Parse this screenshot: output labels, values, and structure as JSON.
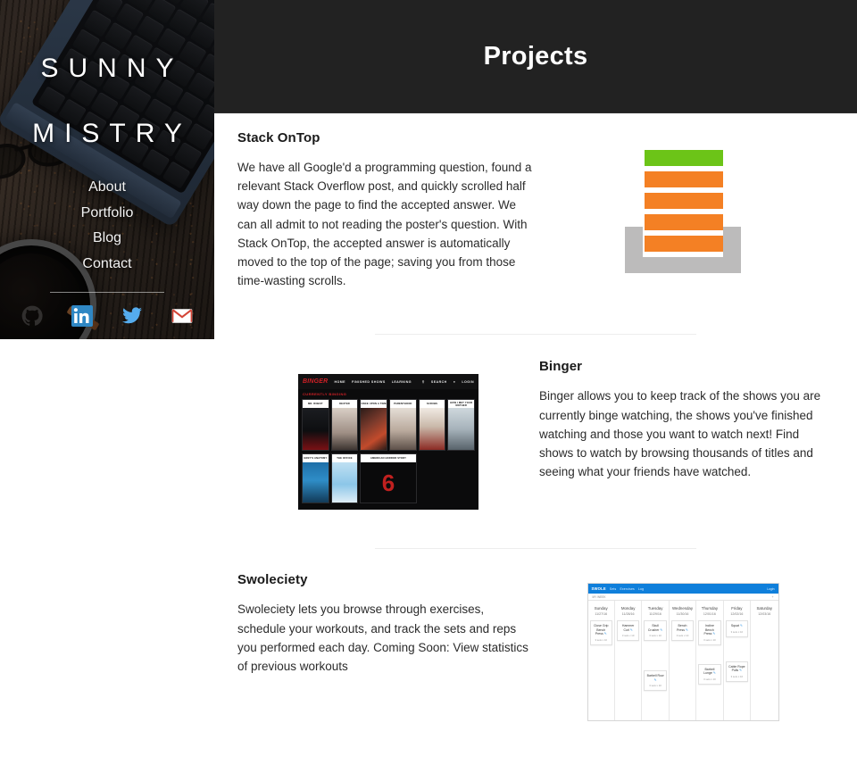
{
  "sidebar": {
    "brand_line1": "SUNNY",
    "brand_line2": "MISTRY",
    "nav": [
      {
        "label": "About"
      },
      {
        "label": "Portfolio"
      },
      {
        "label": "Blog"
      },
      {
        "label": "Contact"
      }
    ],
    "socials": [
      {
        "name": "github-icon",
        "label": "GitHub",
        "color": "#2b2b2b"
      },
      {
        "name": "linkedin-icon",
        "label": "LinkedIn",
        "color": "#2f87c4"
      },
      {
        "name": "twitter-icon",
        "label": "Twitter",
        "color": "#55acee"
      },
      {
        "name": "gmail-icon",
        "label": "Gmail",
        "color": "#d44638"
      }
    ]
  },
  "header": {
    "title": "Projects",
    "background": "#222222"
  },
  "projects": [
    {
      "title": "Stack OnTop",
      "body": "We have all Google'd a programming question, found a relevant Stack Overflow post, and quickly scrolled half way down the page to find the accepted answer. We can all admit to not reading the poster's question. With Stack OnTop, the accepted answer is automatically moved to the top of the page; saving you from those time-wasting scrolls.",
      "media": "stack-ontop-logo",
      "media_alt": "Stack OnTop logo",
      "colors": {
        "accepted": "#6cc418",
        "bars": "#f48024",
        "tray": "#bcbbbb"
      }
    },
    {
      "title": "Binger",
      "body": "Binger allows you to keep track of the shows you are currently binge watching, the shows you've finished watching and those you want to watch next! Find shows to watch by browsing thousands of titles and seeing what your friends have watched.",
      "media": "binger-screenshot",
      "media_alt": "Binger app screenshot"
    },
    {
      "title": "Swoleciety",
      "body": "Swoleciety lets you browse through exercises, schedule your workouts, and track the sets and reps you performed each day. Coming Soon: View statistics of previous workouts",
      "media": "swoleciety-screenshot",
      "media_alt": "Swoleciety app screenshot"
    }
  ],
  "binger_app": {
    "logo": "BINGER",
    "nav": [
      "HOME",
      "FINISHED SHOWS",
      "LEARNING"
    ],
    "actions": [
      "SEARCH",
      "LOGIN"
    ],
    "section_label": "CURRENTLY BINGING",
    "row1": [
      {
        "title": "MR. ROBOT",
        "art": "mr-robot"
      },
      {
        "title": "DEXTER",
        "art": "dexter"
      },
      {
        "title": "ONCE UPON A TIME",
        "art": "once-upon-a-time"
      },
      {
        "title": "PARENTHOOD",
        "art": "parenthood"
      },
      {
        "title": "SCRUBS",
        "art": "scrubs"
      },
      {
        "title": "HOW I MET YOUR MOTHER",
        "art": "himym"
      }
    ],
    "row2": [
      {
        "title": "GREY'S ANATOMY",
        "art": "greys-anatomy"
      },
      {
        "title": "THE OFFICE",
        "art": "the-office"
      },
      {
        "title": "AMERICAN HORROR STORY",
        "art": "ahs"
      }
    ]
  },
  "swoleciety_app": {
    "brand": "SWOLE",
    "nav": [
      "Sets",
      "Exercises",
      "Log"
    ],
    "right_action": "Login",
    "subbar_left": "MY WEEK",
    "subbar_right": "+",
    "days": [
      {
        "name": "Sunday",
        "date": "11/27/16",
        "workouts": [
          {
            "exercise": "Close Grip Bench Press",
            "meta": "3 sets x 10"
          }
        ]
      },
      {
        "name": "Monday",
        "date": "11/28/16",
        "workouts": [
          {
            "exercise": "Hammer Curl",
            "meta": "3 sets x 10"
          }
        ]
      },
      {
        "name": "Tuesday",
        "date": "11/29/16",
        "workouts": [
          {
            "exercise": "Skull Crusher",
            "meta": "3 sets x 10"
          },
          {
            "exercise": "Barbell Row",
            "meta": "3 sets x 10"
          }
        ]
      },
      {
        "name": "Wednesday",
        "date": "11/30/16",
        "workouts": [
          {
            "exercise": "Bench Press",
            "meta": "3 sets x 10"
          }
        ]
      },
      {
        "name": "Thursday",
        "date": "12/01/16",
        "workouts": [
          {
            "exercise": "Incline Bench Press",
            "meta": "3 sets x 10"
          },
          {
            "exercise": "Barbell Lunge",
            "meta": "3 sets x 10"
          }
        ]
      },
      {
        "name": "Friday",
        "date": "12/02/16",
        "workouts": [
          {
            "exercise": "Squat",
            "meta": "3 sets x 10"
          },
          {
            "exercise": "Cable Rope Pulls",
            "meta": "3 sets x 10"
          }
        ]
      },
      {
        "name": "Saturday",
        "date": "12/03/16",
        "workouts": []
      }
    ]
  }
}
